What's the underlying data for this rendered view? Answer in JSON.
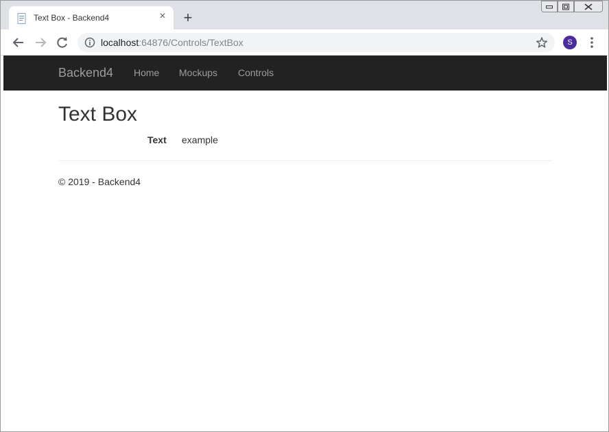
{
  "browser": {
    "tab": {
      "title": "Text Box - Backend4"
    },
    "address_bar": {
      "host": "localhost",
      "path": ":64876/Controls/TextBox"
    },
    "profile_initial": "S"
  },
  "site": {
    "brand": "Backend4",
    "nav": [
      "Home",
      "Mockups",
      "Controls"
    ]
  },
  "page": {
    "title": "Text Box",
    "field_label": "Text",
    "field_value": "example",
    "footer": "© 2019 - Backend4"
  },
  "colors": {
    "navbar_bg": "#222222",
    "nav_text": "#9d9d9d",
    "avatar_bg": "#4b2c9e"
  }
}
